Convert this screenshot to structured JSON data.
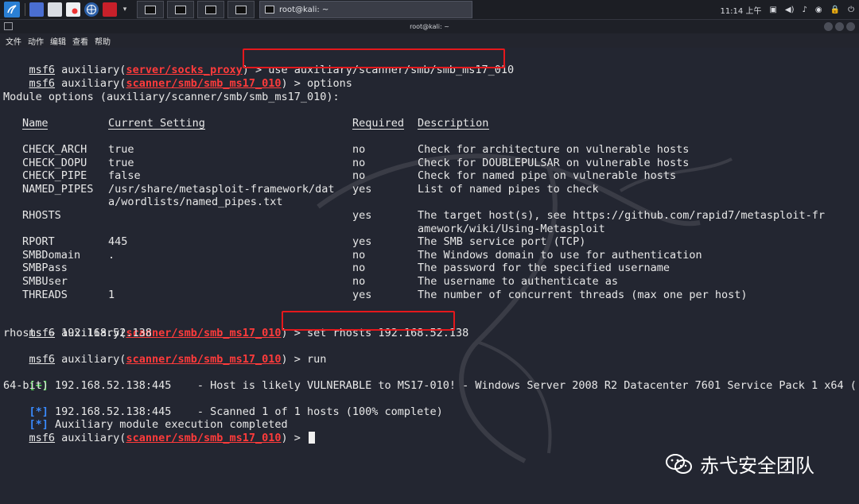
{
  "taskbar": {
    "task_title": "root@kali: ~",
    "clock": "11:14 上午"
  },
  "window": {
    "title": "root@kali: ~"
  },
  "menu": [
    "文件",
    "动作",
    "编辑",
    "查看",
    "帮助"
  ],
  "terminal": {
    "prompt_word": "msf6",
    "line1": {
      "pre": " auxiliary(",
      "module": "server/socks_proxy",
      "post": ") > ",
      "cmd": "use auxiliary/scanner/smb/smb_ms17_010"
    },
    "line2": {
      "pre": " auxiliary(",
      "module": "scanner/smb/smb_ms17_010",
      "post": ") > ",
      "cmd": "options"
    },
    "module_options": "Module options (auxiliary/scanner/smb/smb_ms17_010):",
    "headers": {
      "name": "Name",
      "setting": "Current Setting",
      "required": "Required",
      "description": "Description"
    },
    "options": [
      {
        "name": "CHECK_ARCH",
        "setting": "true",
        "required": "no",
        "desc": "Check for architecture on vulnerable hosts",
        "setting2": "",
        "desc2": ""
      },
      {
        "name": "CHECK_DOPU",
        "setting": "true",
        "required": "no",
        "desc": "Check for DOUBLEPULSAR on vulnerable hosts",
        "setting2": "",
        "desc2": ""
      },
      {
        "name": "CHECK_PIPE",
        "setting": "false",
        "required": "no",
        "desc": "Check for named pipe on vulnerable hosts",
        "setting2": "",
        "desc2": ""
      },
      {
        "name": "NAMED_PIPES",
        "setting": "/usr/share/metasploit-framework/dat",
        "required": "yes",
        "desc": "List of named pipes to check",
        "setting2": "a/wordlists/named_pipes.txt",
        "desc2": ""
      },
      {
        "name": "RHOSTS",
        "setting": "",
        "required": "yes",
        "desc": "The target host(s), see https://github.com/rapid7/metasploit-fr",
        "setting2": "",
        "desc2": "amework/wiki/Using-Metasploit"
      },
      {
        "name": "RPORT",
        "setting": "445",
        "required": "yes",
        "desc": "The SMB service port (TCP)",
        "setting2": "",
        "desc2": ""
      },
      {
        "name": "SMBDomain",
        "setting": ".",
        "required": "no",
        "desc": "The Windows domain to use for authentication",
        "setting2": "",
        "desc2": ""
      },
      {
        "name": "SMBPass",
        "setting": "",
        "required": "no",
        "desc": "The password for the specified username",
        "setting2": "",
        "desc2": ""
      },
      {
        "name": "SMBUser",
        "setting": "",
        "required": "no",
        "desc": "The username to authenticate as",
        "setting2": "",
        "desc2": ""
      },
      {
        "name": "THREADS",
        "setting": "1",
        "required": "yes",
        "desc": "The number of concurrent threads (max one per host)",
        "setting2": "",
        "desc2": ""
      }
    ],
    "set_line": {
      "pre": " auxiliary(",
      "module": "scanner/smb/smb_ms17_010",
      "post": ") > ",
      "cmd": "set rhosts 192.168.52.138"
    },
    "rhosts_out": "rhosts ⇒ 192.168.52.138",
    "run_line": {
      "pre": " auxiliary(",
      "module": "scanner/smb/smb_ms17_010",
      "post": ") > ",
      "cmd": "run"
    },
    "result1": {
      "tag": "[+]",
      "text": " 192.168.52.138:445    - Host is likely VULNERABLE to MS17-010! - Windows Server 2008 R2 Datacenter 7601 Service Pack 1 x64 (",
      "cont": "64-bit)"
    },
    "result2": {
      "tag": "[*]",
      "text": " 192.168.52.138:445    - Scanned 1 of 1 hosts (100% complete)"
    },
    "result3": {
      "tag": "[*]",
      "text": " Auxiliary module execution completed"
    },
    "final_line": {
      "pre": " auxiliary(",
      "module": "scanner/smb/smb_ms17_010",
      "post": ") > "
    }
  },
  "watermark": {
    "text": "赤弋安全团队"
  },
  "colors": {
    "module_red": "#ff3b3b",
    "status_blue": "#3a8bff",
    "status_green": "#4fd34f",
    "highlight_box": "#e5181c"
  }
}
